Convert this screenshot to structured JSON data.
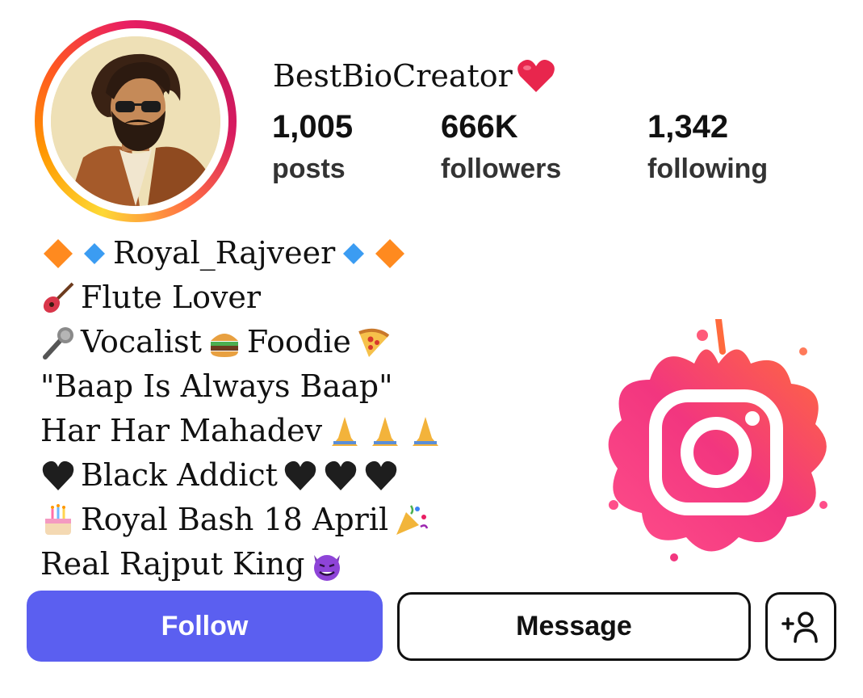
{
  "profile": {
    "username": "BestBioCreator",
    "username_emoji": "heart-icon",
    "avatar": "avatar"
  },
  "stats": [
    {
      "value": "1,005",
      "label": "posts"
    },
    {
      "value": "666K",
      "label": "followers"
    },
    {
      "value": "1,342",
      "label": "following"
    }
  ],
  "bio": {
    "line1": "Royal_Rajveer",
    "line2": "Flute Lover",
    "line3a": "Vocalist",
    "line3b": "Foodie",
    "line4": "\"Baap Is Always Baap\"",
    "line5": "Har Har Mahadev",
    "line6": "Black Addict",
    "line7": "Royal Bash 18 April",
    "line8": "Real Rajput King"
  },
  "actions": {
    "follow_label": "Follow",
    "message_label": "Message",
    "add_user_icon": "add-person-icon"
  },
  "colors": {
    "follow_button": "#5b5ff0",
    "heart": "#e8264d",
    "instagram_gradient_start": "#ff4e50",
    "instagram_gradient_end": "#e91e8c"
  }
}
